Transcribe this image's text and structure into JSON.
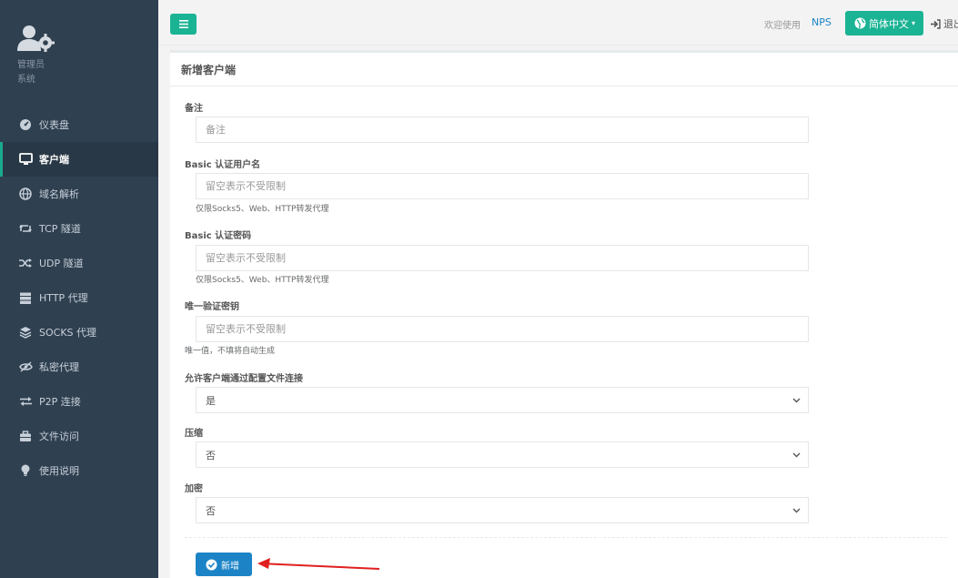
{
  "sidebar": {
    "profile": {
      "name": "管理员",
      "role": "系统"
    },
    "items": [
      {
        "label": "仪表盘",
        "icon": "dashboard-icon"
      },
      {
        "label": "客户端",
        "icon": "desktop-icon",
        "active": true
      },
      {
        "label": "域名解析",
        "icon": "globe-icon"
      },
      {
        "label": "TCP 隧道",
        "icon": "retweet-icon"
      },
      {
        "label": "UDP 隧道",
        "icon": "random-icon"
      },
      {
        "label": "HTTP 代理",
        "icon": "server-icon"
      },
      {
        "label": "SOCKS 代理",
        "icon": "layers-icon"
      },
      {
        "label": "私密代理",
        "icon": "eye-slash-icon"
      },
      {
        "label": "P2P 连接",
        "icon": "exchange-icon"
      },
      {
        "label": "文件访问",
        "icon": "briefcase-icon"
      },
      {
        "label": "使用说明",
        "icon": "lightbulb-icon"
      }
    ]
  },
  "topbar": {
    "welcome": "欢迎使用",
    "brand": "NPS",
    "language": "简体中文",
    "logout": "退出"
  },
  "panel": {
    "title": "新增客户端"
  },
  "form": {
    "remark": {
      "label": "备注",
      "placeholder": "备注"
    },
    "basic_user": {
      "label": "Basic 认证用户名",
      "placeholder": "留空表示不受限制",
      "help": "仅限Socks5、Web、HTTP转发代理"
    },
    "basic_pass": {
      "label": "Basic 认证密码",
      "placeholder": "留空表示不受限制",
      "help": "仅限Socks5、Web、HTTP转发代理"
    },
    "vkey": {
      "label": "唯一验证密钥",
      "placeholder": "留空表示不受限制",
      "help": "唯一值，不填将自动生成"
    },
    "config_conn": {
      "label": "允许客户端通过配置文件连接",
      "value": "是"
    },
    "compress": {
      "label": "压缩",
      "value": "否"
    },
    "crypt": {
      "label": "加密",
      "value": "否"
    },
    "submit": "新增"
  },
  "colors": {
    "sidebar_bg": "#2f4050",
    "accent": "#1ab394",
    "primary": "#1c84c6",
    "arrow": "#e02020"
  }
}
